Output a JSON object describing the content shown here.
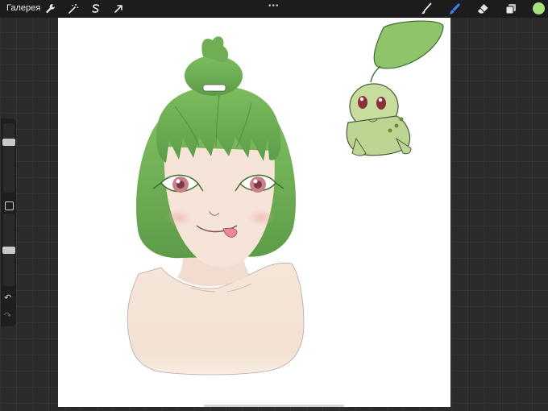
{
  "topbar": {
    "gallery_label": "Галерея",
    "left_tools": [
      "wrench-icon",
      "magic-wand-icon",
      "selection-icon",
      "transform-arrow-icon"
    ],
    "right_tools": [
      "brush-icon",
      "smudge-icon",
      "eraser-icon",
      "layers-icon"
    ],
    "more_glyph": "•••",
    "active_tool": "smudge-icon"
  },
  "colors": {
    "topbar_bg": "#1c1c1c",
    "accent_active": "#3b7ff5",
    "current_color": "#a8e07e",
    "canvas_bg": "#ffffff",
    "hair_green": "#6fae55",
    "skin": "#f4e3d4"
  },
  "sidebar": {
    "brush_size_level": 0.75,
    "opacity_level": 0.5,
    "undo_glyph": "↶",
    "redo_glyph": "↷"
  }
}
